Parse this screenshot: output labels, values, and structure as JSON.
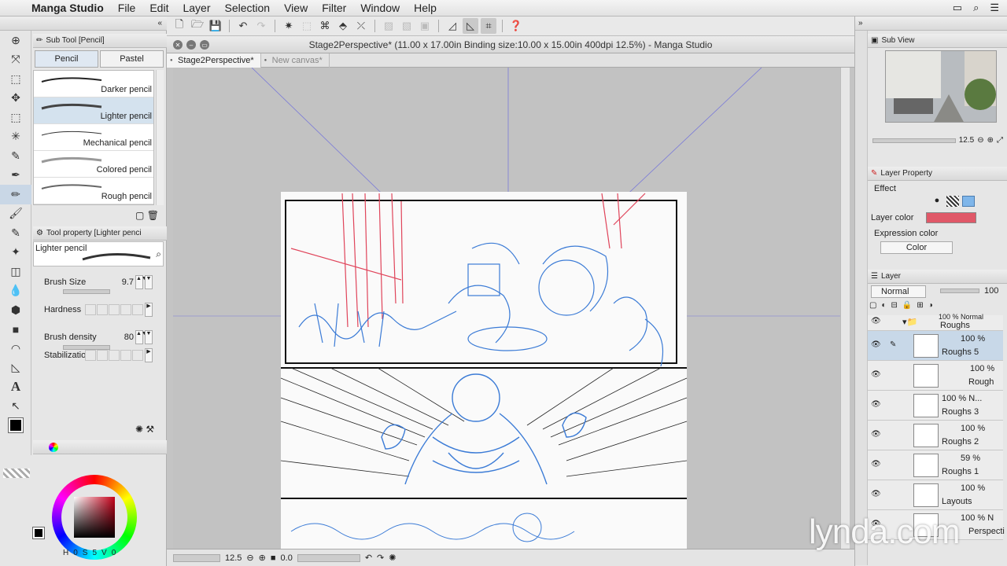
{
  "menubar": {
    "app_name": "Manga Studio",
    "items": [
      "File",
      "Edit",
      "Layer",
      "Selection",
      "View",
      "Filter",
      "Window",
      "Help"
    ]
  },
  "window": {
    "title": "Stage2Perspective* (11.00 x 17.00in Binding size:10.00 x 15.00in 400dpi 12.5%)  - Manga Studio",
    "tabs": [
      "Stage2Perspective*",
      "New canvas*"
    ],
    "zoom": "12.5",
    "angle": "0.0"
  },
  "sub_tool": {
    "panel_title": "Sub Tool [Pencil]",
    "tabs": [
      "Pencil",
      "Pastel"
    ],
    "brushes": [
      "Darker pencil",
      "Lighter pencil",
      "Mechanical pencil",
      "Colored pencil",
      "Rough pencil"
    ],
    "selected_index": 1
  },
  "tool_property": {
    "panel_title": "Tool property [Lighter penci",
    "preset": "Lighter pencil",
    "brush_size_label": "Brush Size",
    "brush_size": "9.7",
    "hardness_label": "Hardness",
    "density_label": "Brush density",
    "density": "80",
    "stabilization_label": "Stabilizatio"
  },
  "color": {
    "current": "#000000",
    "bottom": [
      "H",
      "0",
      "S",
      "5",
      "V",
      "0"
    ]
  },
  "sub_view": {
    "title": "Sub View",
    "zoom": "12.5"
  },
  "layer_property": {
    "title": "Layer Property",
    "effect_label": "Effect",
    "layer_color_label": "Layer color",
    "layer_color": "#e05868",
    "expression_label": "Expression color",
    "expression_value": "Color"
  },
  "layer_panel": {
    "title": "Layer",
    "blend": "Normal",
    "opacity": "100",
    "folder": {
      "pct": "100 % Normal",
      "name": "Roughs"
    },
    "layers": [
      {
        "pct": "100 %",
        "name": "Roughs 5"
      },
      {
        "pct": "100 %",
        "name": "Rough"
      },
      {
        "pct": "100 % N...",
        "name": "Roughs 3"
      },
      {
        "pct": "100 %",
        "name": "Roughs 2"
      },
      {
        "pct": "59 %",
        "name": "Roughs 1"
      },
      {
        "pct": "100 %",
        "name": "Layouts"
      },
      {
        "pct": "100 % N",
        "name": "Perspecti"
      }
    ]
  },
  "watermark": "lynda.com"
}
